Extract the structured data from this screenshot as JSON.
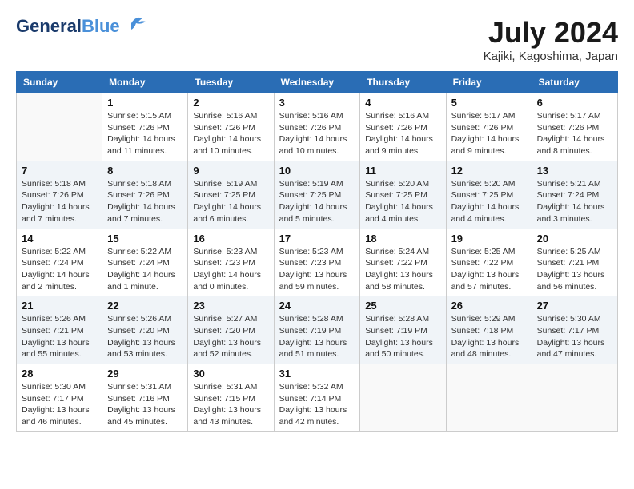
{
  "header": {
    "logo_general": "General",
    "logo_blue": "Blue",
    "month_title": "July 2024",
    "location": "Kajiki, Kagoshima, Japan"
  },
  "columns": [
    "Sunday",
    "Monday",
    "Tuesday",
    "Wednesday",
    "Thursday",
    "Friday",
    "Saturday"
  ],
  "weeks": [
    [
      {
        "day": "",
        "info": ""
      },
      {
        "day": "1",
        "info": "Sunrise: 5:15 AM\nSunset: 7:26 PM\nDaylight: 14 hours\nand 11 minutes."
      },
      {
        "day": "2",
        "info": "Sunrise: 5:16 AM\nSunset: 7:26 PM\nDaylight: 14 hours\nand 10 minutes."
      },
      {
        "day": "3",
        "info": "Sunrise: 5:16 AM\nSunset: 7:26 PM\nDaylight: 14 hours\nand 10 minutes."
      },
      {
        "day": "4",
        "info": "Sunrise: 5:16 AM\nSunset: 7:26 PM\nDaylight: 14 hours\nand 9 minutes."
      },
      {
        "day": "5",
        "info": "Sunrise: 5:17 AM\nSunset: 7:26 PM\nDaylight: 14 hours\nand 9 minutes."
      },
      {
        "day": "6",
        "info": "Sunrise: 5:17 AM\nSunset: 7:26 PM\nDaylight: 14 hours\nand 8 minutes."
      }
    ],
    [
      {
        "day": "7",
        "info": "Sunrise: 5:18 AM\nSunset: 7:26 PM\nDaylight: 14 hours\nand 7 minutes."
      },
      {
        "day": "8",
        "info": "Sunrise: 5:18 AM\nSunset: 7:26 PM\nDaylight: 14 hours\nand 7 minutes."
      },
      {
        "day": "9",
        "info": "Sunrise: 5:19 AM\nSunset: 7:25 PM\nDaylight: 14 hours\nand 6 minutes."
      },
      {
        "day": "10",
        "info": "Sunrise: 5:19 AM\nSunset: 7:25 PM\nDaylight: 14 hours\nand 5 minutes."
      },
      {
        "day": "11",
        "info": "Sunrise: 5:20 AM\nSunset: 7:25 PM\nDaylight: 14 hours\nand 4 minutes."
      },
      {
        "day": "12",
        "info": "Sunrise: 5:20 AM\nSunset: 7:25 PM\nDaylight: 14 hours\nand 4 minutes."
      },
      {
        "day": "13",
        "info": "Sunrise: 5:21 AM\nSunset: 7:24 PM\nDaylight: 14 hours\nand 3 minutes."
      }
    ],
    [
      {
        "day": "14",
        "info": "Sunrise: 5:22 AM\nSunset: 7:24 PM\nDaylight: 14 hours\nand 2 minutes."
      },
      {
        "day": "15",
        "info": "Sunrise: 5:22 AM\nSunset: 7:24 PM\nDaylight: 14 hours\nand 1 minute."
      },
      {
        "day": "16",
        "info": "Sunrise: 5:23 AM\nSunset: 7:23 PM\nDaylight: 14 hours\nand 0 minutes."
      },
      {
        "day": "17",
        "info": "Sunrise: 5:23 AM\nSunset: 7:23 PM\nDaylight: 13 hours\nand 59 minutes."
      },
      {
        "day": "18",
        "info": "Sunrise: 5:24 AM\nSunset: 7:22 PM\nDaylight: 13 hours\nand 58 minutes."
      },
      {
        "day": "19",
        "info": "Sunrise: 5:25 AM\nSunset: 7:22 PM\nDaylight: 13 hours\nand 57 minutes."
      },
      {
        "day": "20",
        "info": "Sunrise: 5:25 AM\nSunset: 7:21 PM\nDaylight: 13 hours\nand 56 minutes."
      }
    ],
    [
      {
        "day": "21",
        "info": "Sunrise: 5:26 AM\nSunset: 7:21 PM\nDaylight: 13 hours\nand 55 minutes."
      },
      {
        "day": "22",
        "info": "Sunrise: 5:26 AM\nSunset: 7:20 PM\nDaylight: 13 hours\nand 53 minutes."
      },
      {
        "day": "23",
        "info": "Sunrise: 5:27 AM\nSunset: 7:20 PM\nDaylight: 13 hours\nand 52 minutes."
      },
      {
        "day": "24",
        "info": "Sunrise: 5:28 AM\nSunset: 7:19 PM\nDaylight: 13 hours\nand 51 minutes."
      },
      {
        "day": "25",
        "info": "Sunrise: 5:28 AM\nSunset: 7:19 PM\nDaylight: 13 hours\nand 50 minutes."
      },
      {
        "day": "26",
        "info": "Sunrise: 5:29 AM\nSunset: 7:18 PM\nDaylight: 13 hours\nand 48 minutes."
      },
      {
        "day": "27",
        "info": "Sunrise: 5:30 AM\nSunset: 7:17 PM\nDaylight: 13 hours\nand 47 minutes."
      }
    ],
    [
      {
        "day": "28",
        "info": "Sunrise: 5:30 AM\nSunset: 7:17 PM\nDaylight: 13 hours\nand 46 minutes."
      },
      {
        "day": "29",
        "info": "Sunrise: 5:31 AM\nSunset: 7:16 PM\nDaylight: 13 hours\nand 45 minutes."
      },
      {
        "day": "30",
        "info": "Sunrise: 5:31 AM\nSunset: 7:15 PM\nDaylight: 13 hours\nand 43 minutes."
      },
      {
        "day": "31",
        "info": "Sunrise: 5:32 AM\nSunset: 7:14 PM\nDaylight: 13 hours\nand 42 minutes."
      },
      {
        "day": "",
        "info": ""
      },
      {
        "day": "",
        "info": ""
      },
      {
        "day": "",
        "info": ""
      }
    ]
  ]
}
